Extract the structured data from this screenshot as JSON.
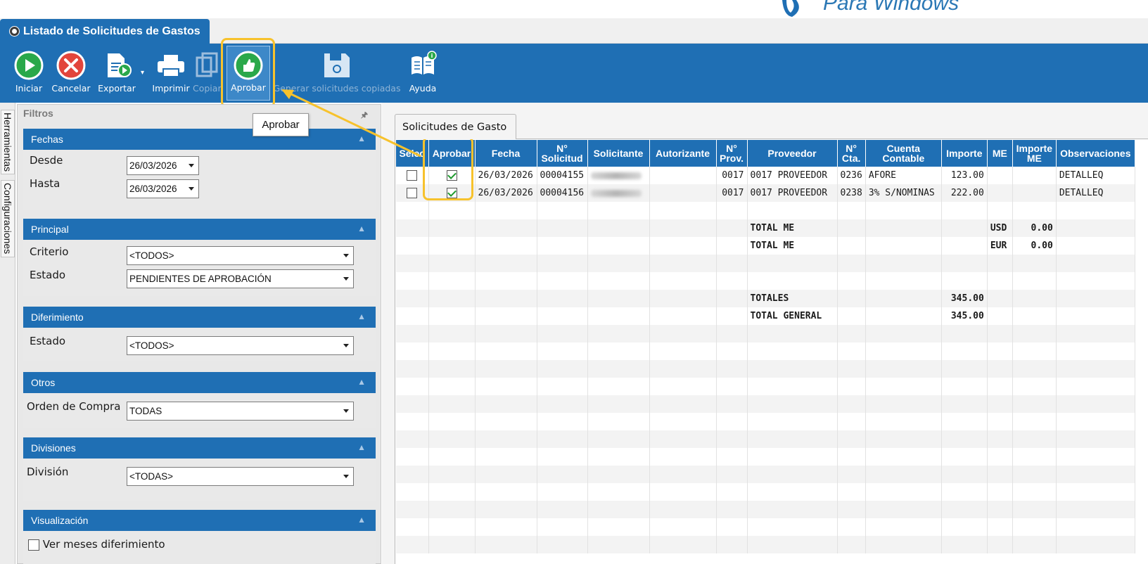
{
  "window": {
    "tab_title": "Listado de Solicitudes de Gastos"
  },
  "logo": {
    "text": "Para Windows",
    "color": "#2b78b5"
  },
  "ribbon": {
    "buttons": [
      {
        "label": "Iniciar",
        "icon": "play-icon"
      },
      {
        "label": "Cancelar",
        "icon": "cancel-icon"
      },
      {
        "label": "Exportar",
        "icon": "export-icon"
      },
      {
        "label": "Imprimir",
        "icon": "printer-icon"
      },
      {
        "label": "Copiar",
        "icon": "copy-icon"
      },
      {
        "label": "Aprobar",
        "icon": "thumbs-up-icon"
      },
      {
        "label": "Generar solicitudes copiadas",
        "icon": "save-icon"
      },
      {
        "label": "Ayuda",
        "icon": "help-book-icon"
      }
    ],
    "tooltip": "Aprobar"
  },
  "side_tabs": [
    "Herramientas",
    "Configuraciones"
  ],
  "filters": {
    "title": "Filtros",
    "fechas": {
      "header": "Fechas",
      "desde_label": "Desde",
      "desde_value": "26/03/2026",
      "hasta_label": "Hasta",
      "hasta_value": "26/03/2026"
    },
    "principal": {
      "header": "Principal",
      "criterio_label": "Criterio",
      "criterio_value": "<TODOS>",
      "estado_label": "Estado",
      "estado_value": "PENDIENTES DE APROBACIÓN"
    },
    "diferimiento": {
      "header": "Diferimiento",
      "estado_label": "Estado",
      "estado_value": "<TODOS>"
    },
    "otros": {
      "header": "Otros",
      "orden_label": "Orden de Compra",
      "orden_value": "TODAS"
    },
    "divisiones": {
      "header": "Divisiones",
      "division_label": "División",
      "division_value": "<TODAS>"
    },
    "visualizacion": {
      "header": "Visualización",
      "ver_meses_label": "Ver meses diferimiento"
    }
  },
  "grid": {
    "tab_label": "Solicitudes de Gasto",
    "columns": [
      {
        "h1": "Selec",
        "h2": ""
      },
      {
        "h1": "Aprobar",
        "h2": ""
      },
      {
        "h1": "Fecha",
        "h2": ""
      },
      {
        "h1": "N°",
        "h2": "Solicitud"
      },
      {
        "h1": "Solicitante",
        "h2": ""
      },
      {
        "h1": "Autorizante",
        "h2": ""
      },
      {
        "h1": "N°",
        "h2": "Prov."
      },
      {
        "h1": "Proveedor",
        "h2": ""
      },
      {
        "h1": "N°",
        "h2": "Cta."
      },
      {
        "h1": "Cuenta",
        "h2": "Contable"
      },
      {
        "h1": "Importe",
        "h2": ""
      },
      {
        "h1": "ME",
        "h2": ""
      },
      {
        "h1": "Importe",
        "h2": "ME"
      },
      {
        "h1": "Observaciones",
        "h2": ""
      }
    ],
    "rows": [
      {
        "selec": false,
        "aprobar": true,
        "fecha": "26/03/2026",
        "solicitud": "00004155",
        "prov": "0017",
        "proveedor": "0017 PROVEEDOR",
        "cta": "0236",
        "cuenta": "AFORE",
        "importe": "123.00",
        "observaciones": "DETALLEQ"
      },
      {
        "selec": false,
        "aprobar": true,
        "fecha": "26/03/2026",
        "solicitud": "00004156",
        "prov": "0017",
        "proveedor": "0017 PROVEEDOR",
        "cta": "0238",
        "cuenta": "3% S/NOMINAS",
        "importe": "222.00",
        "observaciones": "DETALLEQ"
      }
    ],
    "totals": {
      "me_label": "TOTAL ME",
      "usd_label": "USD",
      "usd_value": "0.00",
      "eur_label": "EUR",
      "eur_value": "0.00",
      "totales_label": "TOTALES",
      "totales_value": "345.00",
      "general_label": "TOTAL GENERAL",
      "general_value": "345.00"
    }
  },
  "colors": {
    "primary_blue": "#1f6fb4",
    "highlight_yellow": "#f7c22c"
  }
}
